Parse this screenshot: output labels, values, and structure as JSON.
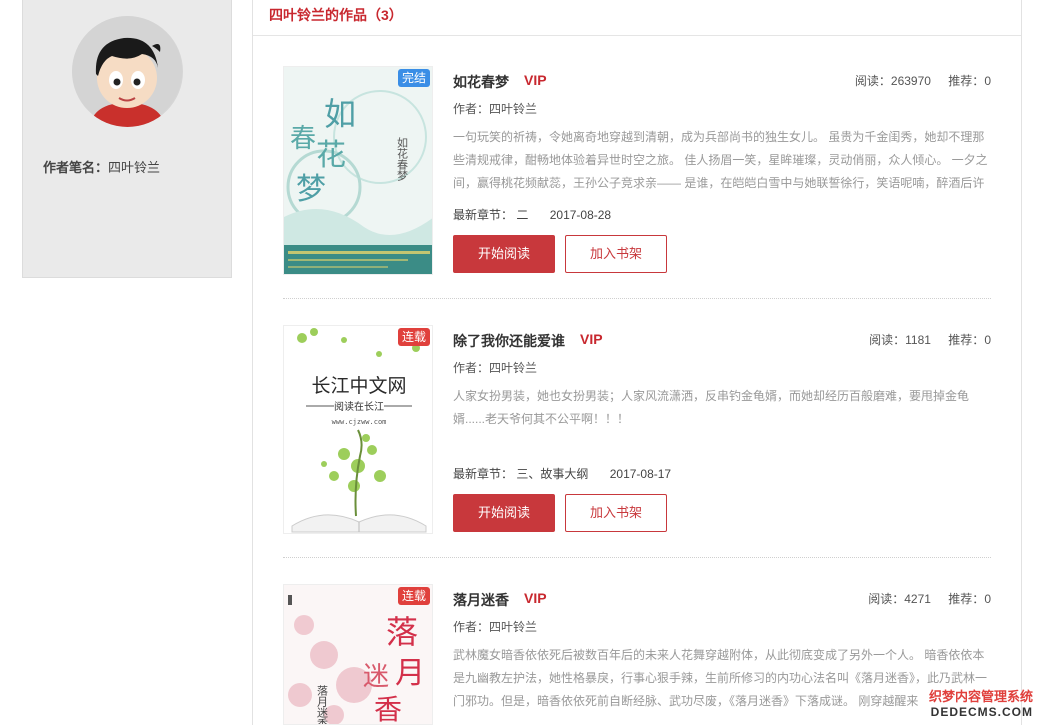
{
  "author": {
    "pen_name_label": "作者笔名：",
    "pen_name": "四叶铃兰"
  },
  "works": {
    "header": "四叶铃兰的作品（3）",
    "read_label": "阅读：",
    "recommend_label": "推荐：",
    "author_label": "作者：",
    "latest_label": "最新章节：",
    "start_reading": "开始阅读",
    "add_shelf": "加入书架",
    "books": [
      {
        "title": "如花春梦",
        "vip": "VIP",
        "badge": "完结",
        "reads": "263970",
        "recommends": "0",
        "author": "四叶铃兰",
        "description": "一句玩笑的祈祷，令她离奇地穿越到清朝，成为兵部尚书的独生女儿。 虽贵为千金闺秀，她却不理那些清规戒律，酣畅地体验着异世时空之旅。 佳人扬眉一笑，星眸璀璨，灵动俏丽，众人倾心。 一夕之间，赢得桃花频献蕊，王孙公子竞求亲—— 是谁，在皑皑白雪中与她联誓徐行，笑语呢喃，醉酒后许",
        "latest_chapter": "二",
        "latest_date": "2017-08-28",
        "cover_title": "如花春梦"
      },
      {
        "title": "除了我你还能爱谁",
        "vip": "VIP",
        "badge": "连载",
        "reads": "1181",
        "recommends": "0",
        "author": "四叶铃兰",
        "description": "人家女扮男装，她也女扮男装；人家风流潇洒，反串钓金龟婿，而她却经历百般磨难，要甩掉金龟婿......老天爷何其不公平啊！！！",
        "latest_chapter": "三、故事大纲",
        "latest_date": "2017-08-17",
        "cover_title": "长江中文网",
        "cover_sub": "阅读在长江",
        "cover_url": "www.cjzww.com"
      },
      {
        "title": "落月迷香",
        "vip": "VIP",
        "badge": "连载",
        "reads": "4271",
        "recommends": "0",
        "author": "四叶铃兰",
        "description": "武林魔女暗香依依死后被数百年后的未来人花舞穿越附体，从此彻底变成了另外一个人。 暗香依依本是九幽教左护法，她性格暴戾，行事心狠手辣，生前所修习的内功心法名叫《落月迷香》，此乃武林一门邪功。但是，暗香依依死前自断经脉、武功尽废，《落月迷香》下落成谜。 刚穿越醒来",
        "cover_title": "落月迷香"
      }
    ]
  },
  "watermark": {
    "line1": "织梦内容管理系统",
    "line2": "DEDECMS.COM"
  }
}
